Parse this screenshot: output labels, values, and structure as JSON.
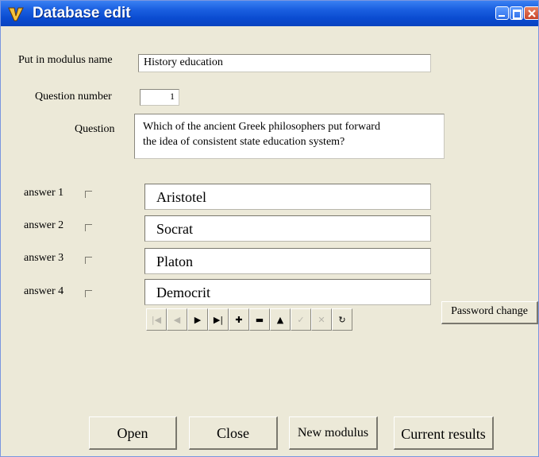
{
  "window": {
    "title": "Database edit"
  },
  "form": {
    "modulus_label": "Put in modulus name",
    "modulus_value": "History education",
    "question_number_label": "Question number",
    "question_number_value": "1",
    "question_label": "Question",
    "question_line1": "Which of the ancient Greek philosophers put forward",
    "question_line2": "the idea of consistent state education system?"
  },
  "answers": [
    {
      "label": "answer 1",
      "value": "Aristotel"
    },
    {
      "label": "answer 2",
      "value": "Socrat"
    },
    {
      "label": "answer 3",
      "value": "Platon"
    },
    {
      "label": "answer 4",
      "value": "Democrit"
    }
  ],
  "navigator": {
    "buttons": [
      {
        "icon": "first-record-icon",
        "glyph": "|◀",
        "enabled": false
      },
      {
        "icon": "prior-record-icon",
        "glyph": "◀",
        "enabled": false
      },
      {
        "icon": "next-record-icon",
        "glyph": "▶",
        "enabled": true
      },
      {
        "icon": "last-record-icon",
        "glyph": "▶|",
        "enabled": true
      },
      {
        "icon": "insert-record-icon",
        "glyph": "✚",
        "enabled": true
      },
      {
        "icon": "delete-record-icon",
        "glyph": "▬",
        "enabled": true
      },
      {
        "icon": "edit-record-icon",
        "glyph": "▲",
        "enabled": true
      },
      {
        "icon": "post-record-icon",
        "glyph": "✓",
        "enabled": false
      },
      {
        "icon": "cancel-record-icon",
        "glyph": "✕",
        "enabled": false
      },
      {
        "icon": "refresh-record-icon",
        "glyph": "↻",
        "enabled": true
      }
    ]
  },
  "buttons": {
    "password_change": "Password change",
    "open": "Open",
    "close": "Close",
    "new_modulus": "New modulus",
    "current_results": "Current results"
  }
}
